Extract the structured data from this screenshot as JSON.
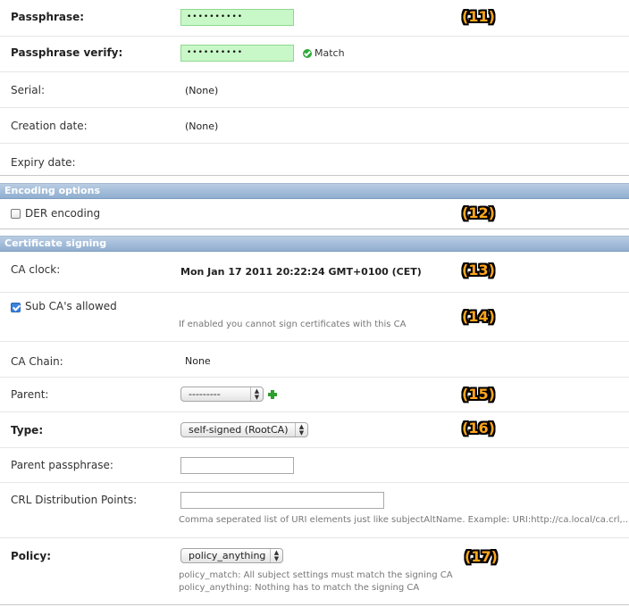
{
  "passphrase": {
    "label": "Passphrase:",
    "value": "••••••••••",
    "badge": "(11)"
  },
  "passphrase_verify": {
    "label": "Passphrase verify:",
    "value": "••••••••••",
    "status": "Match"
  },
  "serial": {
    "label": "Serial:",
    "value": "(None)"
  },
  "creation_date": {
    "label": "Creation date:",
    "value": "(None)"
  },
  "expiry_date": {
    "label": "Expiry date:"
  },
  "encoding_section": {
    "title": "Encoding options",
    "der_label": "DER encoding",
    "der_checked": false,
    "badge": "(12)"
  },
  "signing_section": {
    "title": "Certificate signing"
  },
  "ca_clock": {
    "label": "CA clock:",
    "value": "Mon Jan 17 2011 20:22:24 GMT+0100 (CET)",
    "badge": "(13)"
  },
  "sub_ca": {
    "label": "Sub CA's allowed",
    "checked": true,
    "help": "If enabled you cannot sign certificates with this CA",
    "badge": "(14)"
  },
  "ca_chain": {
    "label": "CA Chain:",
    "value": "None"
  },
  "parent": {
    "label": "Parent:",
    "selected": "---------",
    "badge": "(15)"
  },
  "type": {
    "label": "Type:",
    "selected": "self-signed (RootCA)",
    "badge": "(16)"
  },
  "parent_passphrase": {
    "label": "Parent passphrase:",
    "value": ""
  },
  "crl": {
    "label": "CRL Distribution Points:",
    "value": "",
    "help": "Comma seperated list of URI elements just like subjectAltName. Example: URI:http://ca.local/ca.crl,..."
  },
  "policy": {
    "label": "Policy:",
    "selected": "policy_anything",
    "help_1": "policy_match: All subject settings must match the signing CA",
    "help_2": "policy_anything: Nothing has to match the signing CA",
    "badge": "(17)"
  },
  "colors": {
    "section_bar": "#9fb9d8",
    "valid_input": "#c8f7c8",
    "badge": "#ffa51a",
    "match_icon": "#2eaa3c"
  },
  "icons": {
    "match": "check-circle-icon",
    "add": "plus-icon",
    "select": "up-down-arrows-icon"
  }
}
